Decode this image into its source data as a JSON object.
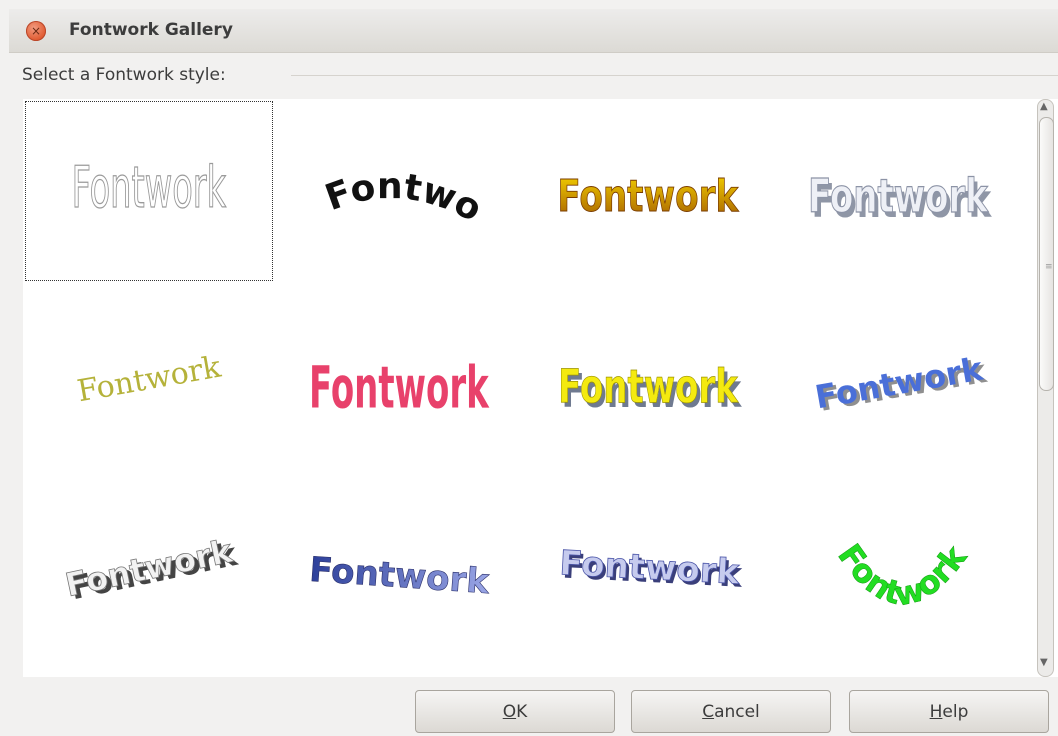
{
  "window": {
    "title": "Fontwork Gallery",
    "close_icon": "close-icon"
  },
  "frame": {
    "label": "Select a Fontwork style:"
  },
  "gallery": {
    "items": [
      {
        "text": "Fontwork",
        "style": "outline-plain",
        "selected": true
      },
      {
        "text": "Fontwork",
        "style": "black-arch"
      },
      {
        "text": "Fontwork",
        "style": "gold-condensed"
      },
      {
        "text": "Fontwork",
        "style": "silver-3d"
      },
      {
        "text": "Fontwork",
        "style": "olive-serif-slant"
      },
      {
        "text": "Fontwork",
        "style": "pink-perspective"
      },
      {
        "text": "Fontwork",
        "style": "yellow-3d"
      },
      {
        "text": "Fontwork",
        "style": "blue-3d-rising"
      },
      {
        "text": "Fontwork",
        "style": "grey-3d-wave"
      },
      {
        "text": "Fontwork",
        "style": "blue-gradient"
      },
      {
        "text": "Fontwork",
        "style": "blue-3d-wave"
      },
      {
        "text": "Fontwork",
        "style": "green-arc"
      }
    ]
  },
  "buttons": {
    "ok": {
      "mnemonic": "O",
      "rest": "K"
    },
    "cancel": {
      "mnemonic": "C",
      "rest": "ancel"
    },
    "help": {
      "mnemonic": "H",
      "rest": "elp"
    }
  },
  "colors": {
    "accent_close": "#e05a30",
    "black": "#111111",
    "gold": "#d9a200",
    "olive": "#b5b23a",
    "pink": "#e8416b",
    "yellow": "#f4ea10",
    "blue": "#4a6fd8",
    "green": "#22dd22"
  }
}
